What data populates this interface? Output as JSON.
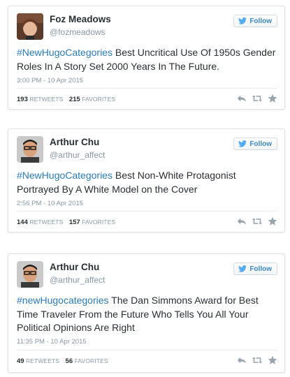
{
  "tweets": [
    {
      "name": "Foz Meadows",
      "handle": "@fozmeadows",
      "follow_label": "Follow",
      "hashtag": "#NewHugoCategories",
      "text": " Best Uncritical Use Of 1950s Gender Roles In A Story Set 2000 Years In The Future.",
      "timestamp": "3:00 PM - 10 Apr 2015",
      "retweets_count": "193",
      "retweets_label": "RETWEETS",
      "favorites_count": "215",
      "favorites_label": "FAVORITES"
    },
    {
      "name": "Arthur Chu",
      "handle": "@arthur_affect",
      "follow_label": "Follow",
      "hashtag": "#NewHugoCategories",
      "text": " Best Non-White Protagonist Portrayed By A White Model on the Cover",
      "timestamp": "2:56 PM - 10 Apr 2015",
      "retweets_count": "144",
      "retweets_label": "RETWEETS",
      "favorites_count": "157",
      "favorites_label": "FAVORITES"
    },
    {
      "name": "Arthur Chu",
      "handle": "@arthur_affect",
      "follow_label": "Follow",
      "hashtag": "#newHugocategories",
      "text": " The Dan Simmons Award for Best Time Traveler From the Future Who Tells You All Your Political Opinions Are Right",
      "timestamp": "11:35 PM - 10 Apr 2015",
      "retweets_count": "49",
      "retweets_label": "RETWEETS",
      "favorites_count": "56",
      "favorites_label": "FAVORITES"
    }
  ],
  "icons": {
    "follow": "twitter-bird-icon",
    "reply": "reply-icon",
    "retweet": "retweet-icon",
    "favorite": "star-icon"
  },
  "colors": {
    "link": "#2b7bb9",
    "follow_text": "#3b88c3",
    "muted": "#8899a6",
    "text": "#292f33"
  }
}
